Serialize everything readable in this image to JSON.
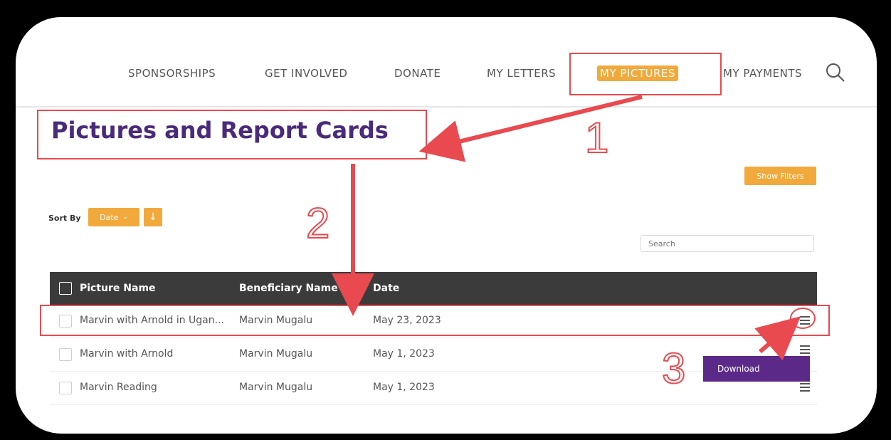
{
  "nav": {
    "items": [
      {
        "label": "SPONSORSHIPS"
      },
      {
        "label": "GET INVOLVED"
      },
      {
        "label": "DONATE"
      },
      {
        "label": "MY LETTERS"
      },
      {
        "label": "MY PICTURES",
        "active": true
      },
      {
        "label": "MY PAYMENTS"
      }
    ],
    "search_icon": "search-icon"
  },
  "page": {
    "title": "Pictures and Report Cards",
    "show_filters_label": "Show Filters",
    "sort_by_label": "Sort By",
    "sort_value": "Date",
    "sort_direction_icon": "arrow-down-icon",
    "search_placeholder": "Search"
  },
  "table": {
    "headers": [
      "Picture Name",
      "Beneficiary Name",
      "Date"
    ],
    "rows": [
      {
        "picture_name": "Marvin with Arnold in Ugan...",
        "beneficiary": "Marvin Mugalu",
        "date": "May 23, 2023"
      },
      {
        "picture_name": "Marvin with Arnold",
        "beneficiary": "Marvin Mugalu",
        "date": "May 1, 2023"
      },
      {
        "picture_name": "Marvin Reading",
        "beneficiary": "Marvin Mugalu",
        "date": "May 1, 2023"
      }
    ]
  },
  "row_menu": {
    "download_label": "Download"
  },
  "annotations": {
    "step1": "1",
    "step2": "2",
    "step3": "3"
  },
  "colors": {
    "accent_orange": "#f2a93b",
    "title_purple": "#4a2a7a",
    "menu_purple": "#5b2a88",
    "annotation_red": "#e84a4f",
    "table_header": "#3b3b3b"
  }
}
